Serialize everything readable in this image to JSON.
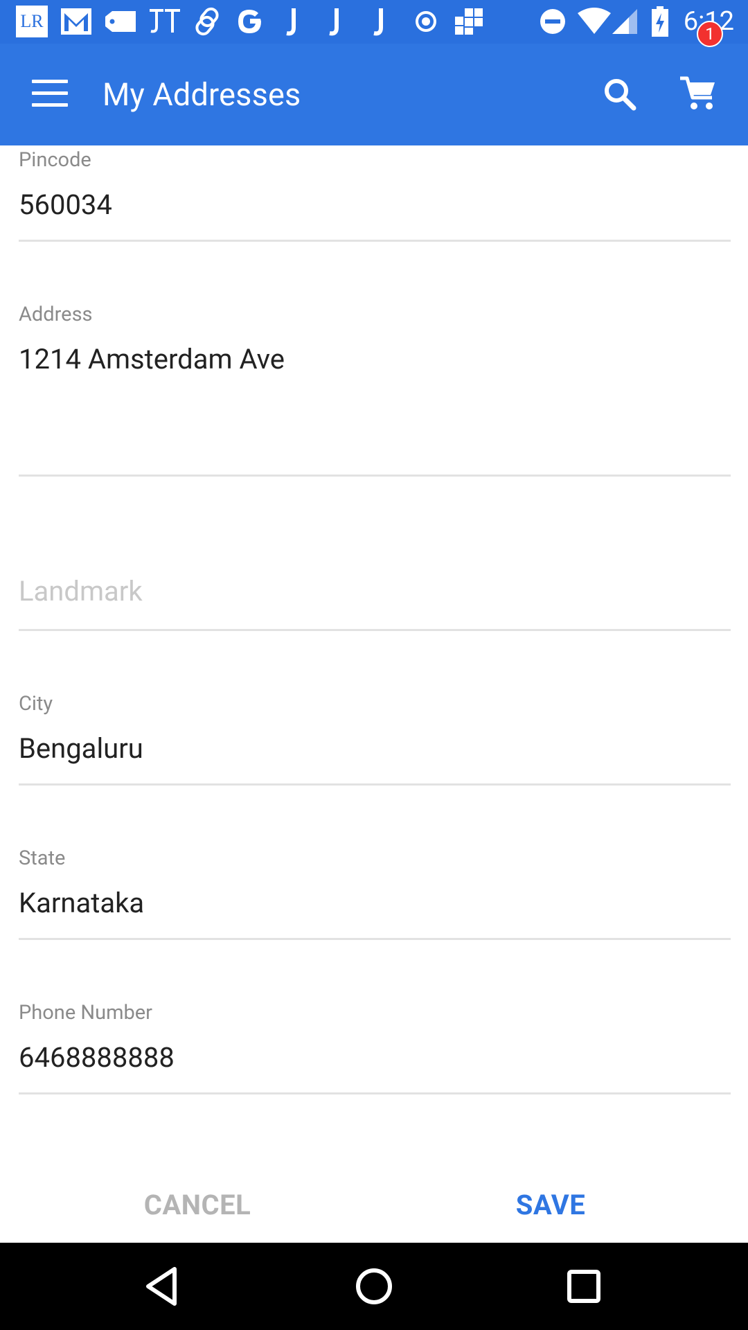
{
  "status_bar": {
    "time": "6:12",
    "icons": [
      "lr-app-icon",
      "gmail-icon",
      "tag-icon",
      "jt-app-icon",
      "link-app-icon",
      "google-icon",
      "j-app-icon",
      "j-app-icon",
      "j-app-icon",
      "target-icon",
      "grid-app-icon",
      "do-not-disturb-icon",
      "wifi-icon",
      "cell-signal-icon",
      "battery-charging-icon"
    ],
    "lr_text": "LR"
  },
  "app_bar": {
    "title": "My Addresses",
    "cart_count": "1",
    "background": "#2f76e2"
  },
  "form": {
    "pincode": {
      "label": "Pincode",
      "value": "560034"
    },
    "address": {
      "label": "Address",
      "value": "1214 Amsterdam Ave"
    },
    "landmark": {
      "placeholder": "Landmark",
      "value": ""
    },
    "city": {
      "label": "City",
      "value": "Bengaluru"
    },
    "state": {
      "label": "State",
      "value": "Karnataka"
    },
    "phone": {
      "label": "Phone Number",
      "value": "6468888888"
    }
  },
  "actions": {
    "cancel_label": "CANCEL",
    "save_label": "SAVE",
    "accent": "#2f76e2"
  },
  "nav_bar": {
    "icons": [
      "back-icon",
      "home-icon",
      "recents-icon"
    ]
  }
}
